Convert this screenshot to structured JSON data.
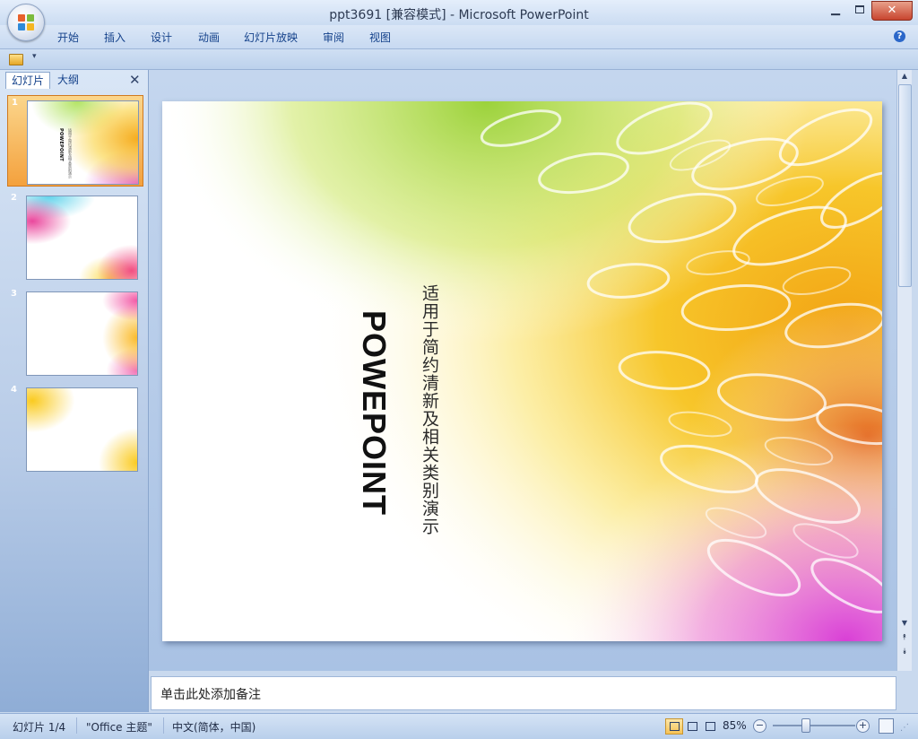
{
  "window": {
    "title": "ppt3691 [兼容模式] - Microsoft PowerPoint",
    "minimize": "▁",
    "close": "✕"
  },
  "ribbon": {
    "tabs": [
      "开始",
      "插入",
      "设计",
      "动画",
      "幻灯片放映",
      "审阅",
      "视图"
    ],
    "help": "?"
  },
  "quick_access": {
    "dropdown": "▾"
  },
  "left_panel": {
    "tabs": [
      "幻灯片",
      "大纲"
    ],
    "close": "✕",
    "slides": [
      {
        "number": "1",
        "selected": true
      },
      {
        "number": "2",
        "selected": false
      },
      {
        "number": "3",
        "selected": false
      },
      {
        "number": "4",
        "selected": false
      }
    ]
  },
  "slide": {
    "title": "POWEPOINT",
    "subtitle": "适用于简约清新及相关类别演示"
  },
  "scrollbar": {
    "up": "▲",
    "down": "▼",
    "prev": "⯭",
    "next": "⯯"
  },
  "notes": {
    "placeholder": "单击此处添加备注"
  },
  "status": {
    "slide_counter": "幻灯片 1/4",
    "theme": "\"Office 主题\"",
    "language": "中文(简体，中国)",
    "zoom": "85%",
    "zoom_minus": "−",
    "zoom_plus": "+"
  },
  "colors": {
    "ribbon_text": "#15428b",
    "selected_thumb": "#f4a13d",
    "close_button": "#c8452f"
  }
}
